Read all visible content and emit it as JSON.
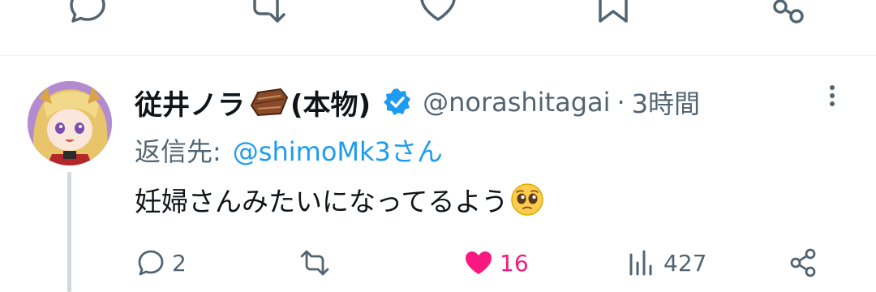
{
  "colors": {
    "text_primary": "#0f1419",
    "text_secondary": "#536471",
    "link": "#1d9bf0",
    "like": "#f91880",
    "verified": "#1d9bf0"
  },
  "top_actions": {
    "icons": [
      "reply-icon",
      "retweet-icon",
      "like-icon",
      "bookmark-icon",
      "share-icon"
    ]
  },
  "tweet": {
    "display_name": "従井ノラ",
    "name_suffix": "(本物)",
    "handle": "@norashitagai",
    "separator": "·",
    "time": "3時間",
    "reply_label": "返信先:",
    "reply_user": "@shimoMk3さん",
    "text": "妊婦さんみたいになってるよう",
    "actions": {
      "replies": "2",
      "retweets": "",
      "likes": "16",
      "views": "427"
    }
  }
}
